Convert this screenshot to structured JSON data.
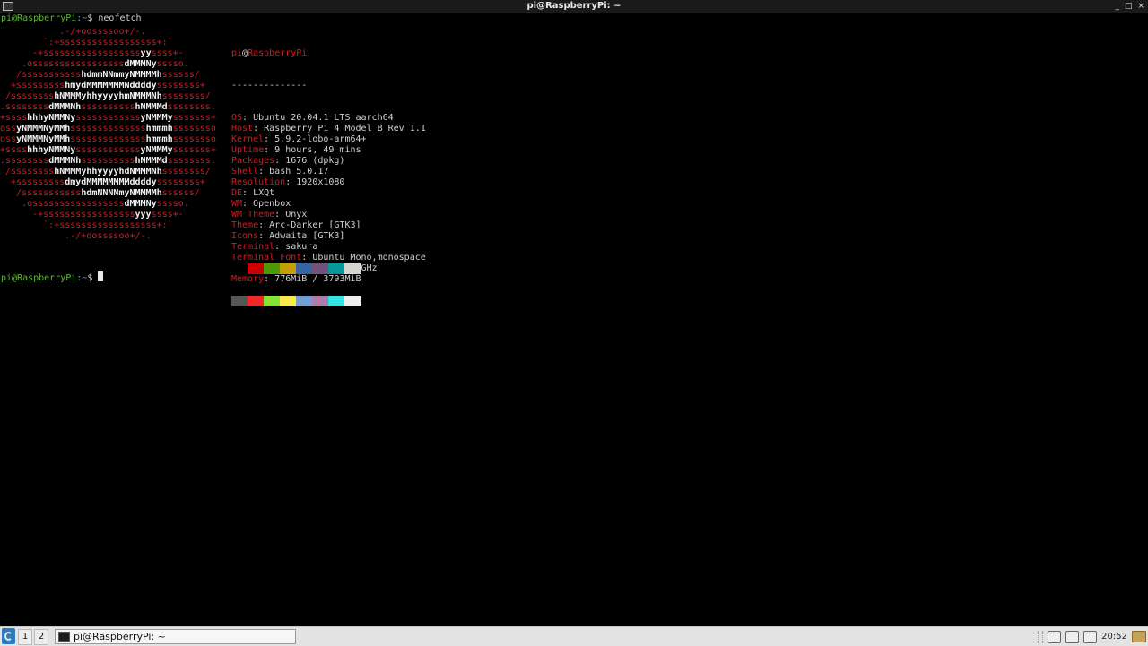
{
  "window": {
    "title": "pi@RaspberryPi: ~",
    "controls": [
      "_",
      "□",
      "×"
    ]
  },
  "terminal": {
    "prompt1": {
      "user": "pi@RaspberryPi",
      "path": ":~",
      "sign": "$ ",
      "command": "neofetch"
    },
    "prompt2": {
      "user": "pi@RaspberryPi",
      "path": ":~",
      "sign": "$ "
    },
    "logo": [
      "           .-/+oossssoo+/-.",
      "        `:+ssssssssssssssssss+:`",
      "      -+ssssssssssssssssssyyssss+-",
      "    .osssssssssssssssssdMMMNysssso.",
      "   /ssssssssssshdmmNNmmyNMMMMhssssss/",
      "  +ssssssssshmydMMMMMMMNddddyssssssss+",
      " /sssssssshNMMMyhhyyyyhmNMMMNhssssssss/",
      ".ssssssssdMMMNhsssssssssshNMMMdssssssss.",
      "+sssshhhyNMMNyssssssssssssyNMMMysssssss+",
      "ossyNMMMNyMMhsssssssssssssshmmmhssssssso",
      "ossyNMMMNyMMhsssssssssssssshmmmhssssssso",
      "+sssshhhyNMMNyssssssssssssyNMMMysssssss+",
      ".ssssssssdMMMNhsssssssssshNMMMdssssssss.",
      " /sssssssshNMMMyhhyyyyhdNMMMNhssssssss/",
      "  +sssssssssdmydMMMMMMMMddddyssssssss+",
      "   /ssssssssssshdmNNNNmyNMMMMhssssss/",
      "    .osssssssssssssssssdMMMNysssso.",
      "      -+sssssssssssssssssyyyssss+-",
      "        `:+ssssssssssssssssss+:`",
      "            .-/+oossssoo+/-."
    ],
    "info": {
      "user": "pi",
      "at": "@",
      "host": "RaspberryPi",
      "separator": "--------------",
      "fields": [
        {
          "key": "OS",
          "value": "Ubuntu 20.04.1 LTS aarch64"
        },
        {
          "key": "Host",
          "value": "Raspberry Pi 4 Model B Rev 1.1"
        },
        {
          "key": "Kernel",
          "value": "5.9.2-lobo-arm64+"
        },
        {
          "key": "Uptime",
          "value": "9 hours, 49 mins"
        },
        {
          "key": "Packages",
          "value": "1676 (dpkg)"
        },
        {
          "key": "Shell",
          "value": "bash 5.0.17"
        },
        {
          "key": "Resolution",
          "value": "1920x1080"
        },
        {
          "key": "DE",
          "value": "LXQt"
        },
        {
          "key": "WM",
          "value": "Openbox"
        },
        {
          "key": "WM Theme",
          "value": "Onyx"
        },
        {
          "key": "Theme",
          "value": "Arc-Darker [GTK3]"
        },
        {
          "key": "Icons",
          "value": "Adwaita [GTK3]"
        },
        {
          "key": "Terminal",
          "value": "sakura"
        },
        {
          "key": "Terminal Font",
          "value": "Ubuntu Mono,monospace"
        },
        {
          "key": "CPU",
          "value": "BCM2835 (4) @ 1.900GHz"
        },
        {
          "key": "Memory",
          "value": "776MiB / 3793MiB"
        }
      ]
    },
    "palette": {
      "normal": [
        "#000000",
        "#cc0000",
        "#4e9a06",
        "#c4a000",
        "#3465a4",
        "#75507b",
        "#06989a",
        "#d3d7cf"
      ],
      "bright": [
        "#555753",
        "#ef2929",
        "#8ae234",
        "#fce94f",
        "#729fcf",
        "#ad7fa8",
        "#34e2e2",
        "#eeeeec"
      ]
    },
    "colors": {
      "user": "#5fb73a",
      "path": "#7a90d6",
      "accent": "#d9181e"
    }
  },
  "taskbar": {
    "menu_icon": "lxqt-menu-icon",
    "workspaces": [
      "1",
      "2"
    ],
    "task_label": "pi@RaspberryPi: ~",
    "clock": "20:52",
    "tray_icons": [
      "search-icon",
      "keyboard-icon",
      "volume-icon",
      "folder-icon"
    ]
  }
}
